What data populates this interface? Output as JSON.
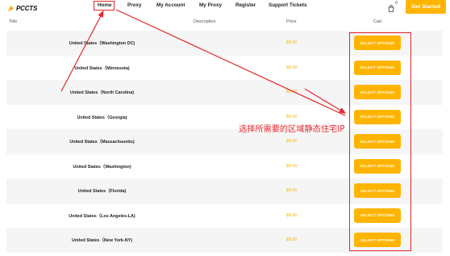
{
  "header": {
    "logo_text": "PCCTS",
    "nav": {
      "home": "Home",
      "proxy": "Proxy",
      "my_account": "My Account",
      "my_proxy": "My Proxy",
      "register": "Register",
      "support_tickets": "Support Tickets"
    },
    "cart_count": "0",
    "get_started": "Get Started"
  },
  "table": {
    "columns": {
      "title": "Title",
      "description": "Description",
      "price": "Price",
      "cart": "Cart"
    },
    "rows": [
      {
        "title": "United States（Washington DC)",
        "price": "$9.90",
        "button": "SELECT OPTIONS"
      },
      {
        "title": "United States（Minnesota)",
        "price": "$9.90",
        "button": "SELECT OPTIONS"
      },
      {
        "title": "United States（North Carolina)",
        "price": "$9.90",
        "button": "SELECT OPTIONS"
      },
      {
        "title": "United States（Georgia)",
        "price": "$9.90",
        "button": "SELECT OPTIONS"
      },
      {
        "title": "United States（Massachusetts)",
        "price": "$9.90",
        "button": "SELECT OPTIONS"
      },
      {
        "title": "United States（Washington)",
        "price": "$9.90",
        "button": "SELECT OPTIONS"
      },
      {
        "title": "United States（Florida)",
        "price": "$9.90",
        "button": "SELECT OPTIONS"
      },
      {
        "title": "United States（Los Angeles-LA)",
        "price": "$9.90",
        "button": "SELECT OPTIONS"
      },
      {
        "title": "United States（New York-NY)",
        "price": "$9.90",
        "button": "SELECT OPTIONS"
      }
    ]
  },
  "annotation": {
    "text": "选择所需要的区域静态住宅IP",
    "color": "#e3262b"
  },
  "colors": {
    "accent": "#ffb400",
    "annotation_red": "#e3262b",
    "row_shade": "#f5f5f5"
  }
}
